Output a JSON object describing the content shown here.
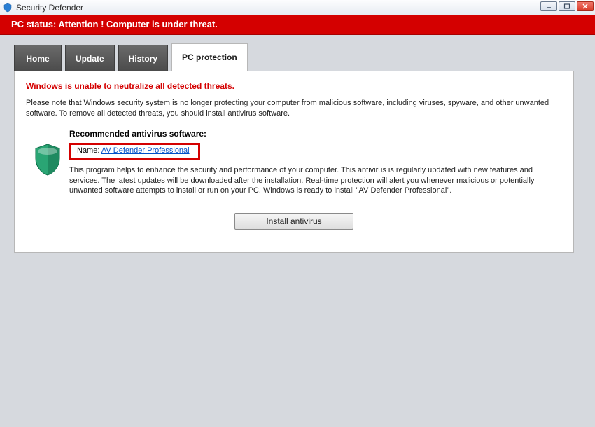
{
  "window": {
    "title": "Security Defender"
  },
  "status": {
    "text": "PC status: Attention ! Computer is under threat."
  },
  "tabs": [
    {
      "label": "Home"
    },
    {
      "label": "Update"
    },
    {
      "label": "History"
    },
    {
      "label": "PC protection",
      "active": true
    }
  ],
  "panel": {
    "alert_heading": "Windows is unable to neutralize all detected threats.",
    "note": "Please note that Windows security system is no longer protecting your computer from malicious software, including viruses, spyware, and other unwanted software. To remove all detected threats, you should install antivirus software.",
    "recommended_title": "Recommended antivirus software:",
    "name_label": "Name: ",
    "name_link": "AV Defender Professional",
    "description": "This program helps to enhance the security and performance of your computer. This antivirus is regularly updated with new features and services. The latest updates will be downloaded after the installation. Real-time protection will alert you whenever malicious or potentially unwanted software attempts to install or run on your PC. Windows is ready to install \"AV Defender Professional\".",
    "install_label": "Install antivirus"
  }
}
